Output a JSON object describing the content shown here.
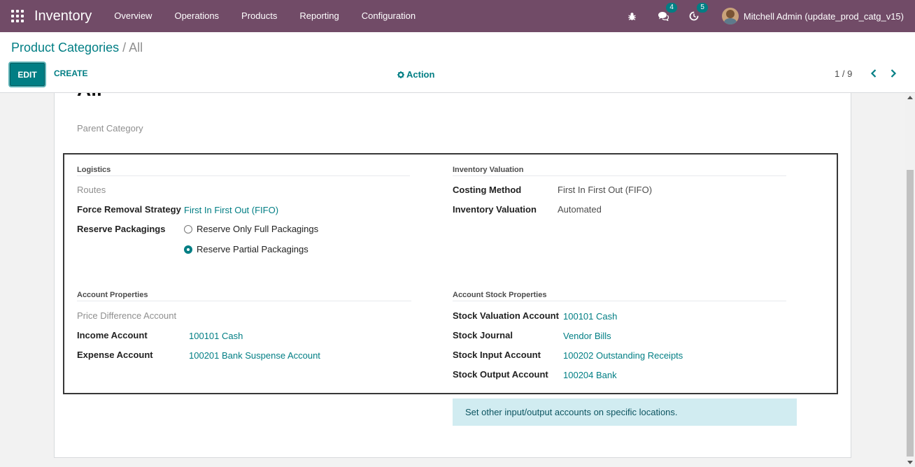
{
  "navbar": {
    "brand": "Inventory",
    "menu": [
      "Overview",
      "Operations",
      "Products",
      "Reporting",
      "Configuration"
    ],
    "messages_count": "4",
    "activities_count": "5",
    "user_name": "Mitchell Admin (update_prod_catg_v15)"
  },
  "control": {
    "breadcrumb_parent": "Product Categories",
    "breadcrumb_sep": " / ",
    "breadcrumb_current": "All",
    "edit_label": "EDIT",
    "create_label": "CREATE",
    "action_label": "Action",
    "pager": "1 / 9"
  },
  "form": {
    "title": "All",
    "parent_category_label": "Parent Category",
    "logistics": {
      "title": "Logistics",
      "routes_label": "Routes",
      "removal_label": "Force Removal Strategy",
      "removal_value": "First In First Out (FIFO)",
      "packagings_label": "Reserve Packagings",
      "option_full": "Reserve Only Full Packagings",
      "option_partial": "Reserve Partial Packagings"
    },
    "valuation": {
      "title": "Inventory Valuation",
      "costing_label": "Costing Method",
      "costing_value": "First In First Out (FIFO)",
      "valuation_label": "Inventory Valuation",
      "valuation_value": "Automated"
    },
    "account": {
      "title": "Account Properties",
      "price_diff_label": "Price Difference Account",
      "income_label": "Income Account",
      "income_value": "100101 Cash",
      "expense_label": "Expense Account",
      "expense_value": "100201 Bank Suspense Account"
    },
    "stock_account": {
      "title": "Account Stock Properties",
      "valuation_label": "Stock Valuation Account",
      "valuation_value": "100101 Cash",
      "journal_label": "Stock Journal",
      "journal_value": "Vendor Bills",
      "input_label": "Stock Input Account",
      "input_value": "100202 Outstanding Receipts",
      "output_label": "Stock Output Account",
      "output_value": "100204 Bank"
    },
    "info_alert": "Set other input/output accounts on specific locations."
  },
  "colors": {
    "navbar": "#714B67",
    "accent": "#017e84",
    "alert_bg": "#d1ecf1"
  }
}
